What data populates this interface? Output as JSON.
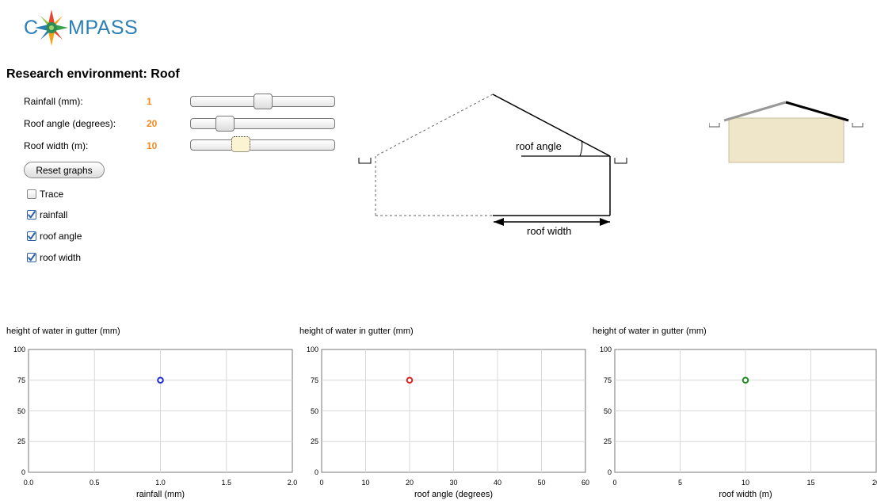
{
  "app": {
    "logo_text_left": "C",
    "logo_text_right": "MPASS"
  },
  "page": {
    "title": "Research environment: Roof"
  },
  "controls": {
    "rainfall": {
      "label": "Rainfall (mm):",
      "value": "1",
      "fraction": 0.5
    },
    "roof_angle": {
      "label": "Roof angle (degrees):",
      "value": "20",
      "fraction": 0.2
    },
    "roof_width": {
      "label": "Roof width (m):",
      "value": "10",
      "fraction": 0.33
    },
    "reset_label": "Reset graphs",
    "checkboxes": [
      {
        "label": "Trace",
        "checked": false
      },
      {
        "label": "rainfall",
        "checked": true
      },
      {
        "label": "roof angle",
        "checked": true
      },
      {
        "label": "roof width",
        "checked": true
      }
    ]
  },
  "diagram": {
    "angle_label": "roof angle",
    "width_label": "roof width"
  },
  "colors": {
    "accent_value": "#f28a1e",
    "series_rainfall": "#1f2bd6",
    "series_angle": "#e02020",
    "series_width": "#1f8a1f",
    "checkbox_check": "#2e5fa4"
  },
  "chart_data": [
    {
      "type": "scatter",
      "title": "height of water in gutter (mm)",
      "xlabel": "rainfall (mm)",
      "xlim": [
        0,
        2
      ],
      "ylim": [
        0,
        100
      ],
      "xticks": [
        "0.0",
        "0.5",
        "1.0",
        "1.5",
        "2.0"
      ],
      "yticks": [
        "0",
        "25",
        "50",
        "75",
        "100"
      ],
      "points": [
        {
          "x": 1.0,
          "y": 75
        }
      ],
      "color": "#1f2bd6",
      "grid": true
    },
    {
      "type": "scatter",
      "title": "height of water in gutter (mm)",
      "xlabel": "roof angle (degrees)",
      "xlim": [
        0,
        60
      ],
      "ylim": [
        0,
        100
      ],
      "xticks": [
        "0",
        "10",
        "20",
        "30",
        "40",
        "50",
        "60"
      ],
      "yticks": [
        "0",
        "25",
        "50",
        "75",
        "100"
      ],
      "points": [
        {
          "x": 20,
          "y": 75
        }
      ],
      "color": "#e02020",
      "grid": true
    },
    {
      "type": "scatter",
      "title": "height of water in gutter (mm)",
      "xlabel": "roof width (m)",
      "xlim": [
        0,
        20
      ],
      "ylim": [
        0,
        100
      ],
      "xticks": [
        "0",
        "5",
        "10",
        "15",
        "20"
      ],
      "yticks": [
        "0",
        "25",
        "50",
        "75",
        "100"
      ],
      "points": [
        {
          "x": 10,
          "y": 75
        }
      ],
      "color": "#1f8a1f",
      "grid": true
    }
  ]
}
